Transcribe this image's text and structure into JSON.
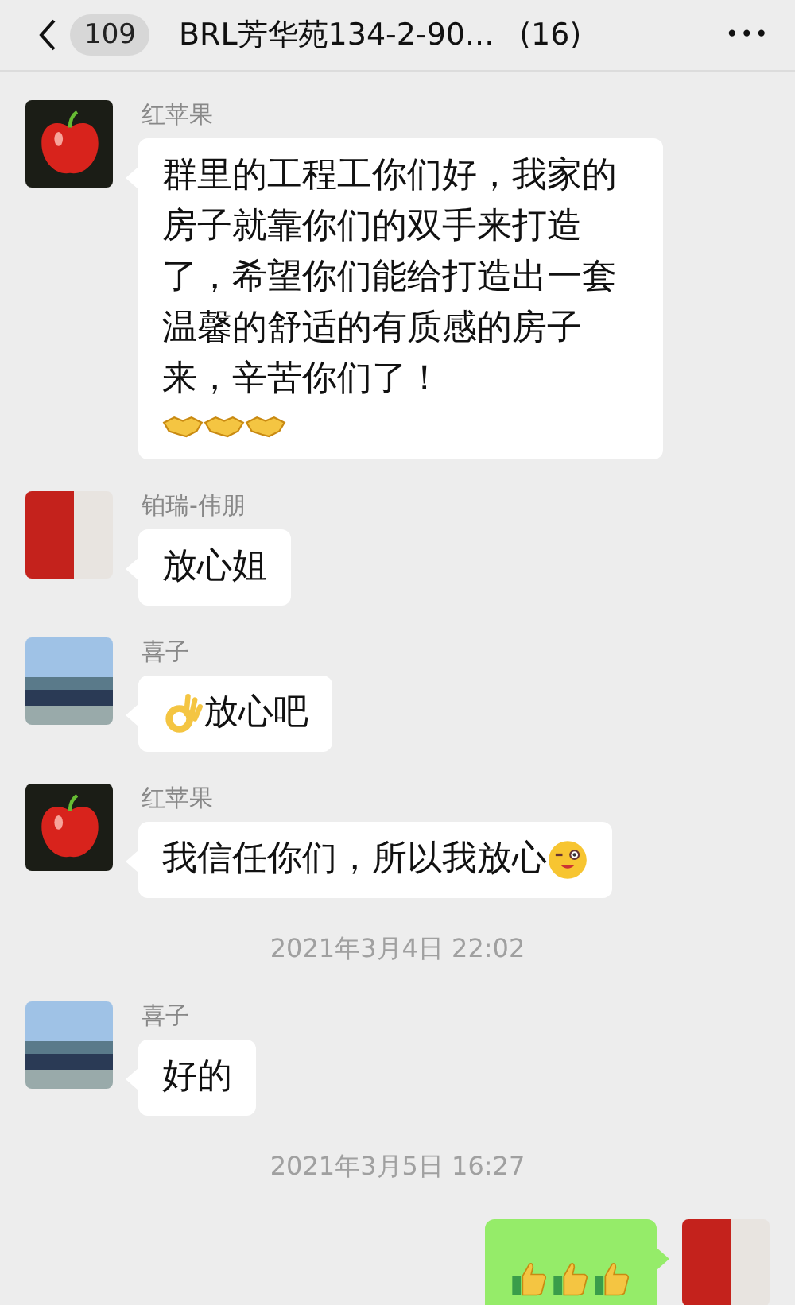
{
  "header": {
    "back_count": "109",
    "title": "BRL芳华苑134-2-90...",
    "member_count": "(16)",
    "more": "•••"
  },
  "messages": [
    {
      "kind": "message",
      "outgoing": false,
      "avatar": {
        "kind": "apple"
      },
      "sender": "红苹果",
      "parts": [
        {
          "kind": "text",
          "text": "群里的工程工你们好，我家的房子就靠你们的双手来打造了，希望你们能给打造出一套温馨的舒适的有质感的房子来，辛苦你们了！"
        },
        {
          "kind": "handshake"
        },
        {
          "kind": "handshake"
        },
        {
          "kind": "handshake"
        }
      ]
    },
    {
      "kind": "message",
      "outgoing": false,
      "avatar": {
        "kind": "photo"
      },
      "sender": "铂瑞-伟朋",
      "parts": [
        {
          "kind": "text",
          "text": "放心姐"
        }
      ]
    },
    {
      "kind": "message",
      "outgoing": false,
      "avatar": {
        "kind": "car"
      },
      "sender": "喜子",
      "parts": [
        {
          "kind": "ok-hand"
        },
        {
          "kind": "text",
          "text": "放心吧"
        }
      ]
    },
    {
      "kind": "message",
      "outgoing": false,
      "avatar": {
        "kind": "apple"
      },
      "sender": "红苹果",
      "parts": [
        {
          "kind": "text",
          "text": "我信任你们，所以我放心"
        },
        {
          "kind": "wink"
        }
      ]
    },
    {
      "kind": "time",
      "text": "2021年3月4日 22:02"
    },
    {
      "kind": "message",
      "outgoing": false,
      "avatar": {
        "kind": "car"
      },
      "sender": "喜子",
      "parts": [
        {
          "kind": "text",
          "text": "好的"
        }
      ]
    },
    {
      "kind": "time",
      "text": "2021年3月5日 16:27"
    },
    {
      "kind": "message",
      "outgoing": true,
      "avatar": {
        "kind": "photo"
      },
      "parts": [
        {
          "kind": "thumbs-up"
        },
        {
          "kind": "thumbs-up"
        },
        {
          "kind": "thumbs-up"
        }
      ]
    }
  ]
}
